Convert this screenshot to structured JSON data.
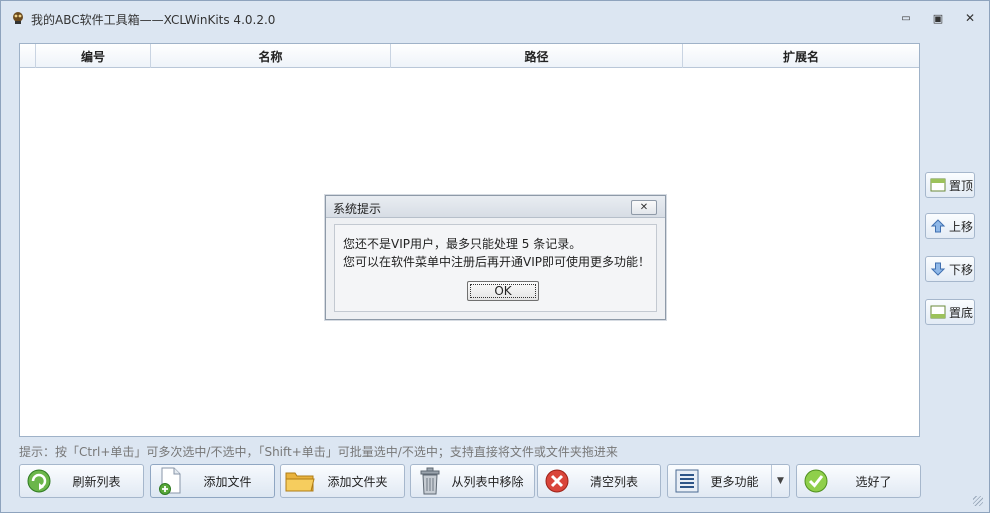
{
  "window": {
    "title": "我的ABC软件工具箱——XCLWinKits   4.0.2.0",
    "minimize_glyph": "▭",
    "maximize_glyph": "▣",
    "close_glyph": "✕"
  },
  "table": {
    "columns": [
      "",
      "编号",
      "名称",
      "路径",
      "扩展名"
    ],
    "rows": []
  },
  "side_buttons": {
    "top": "置顶",
    "up": "上移",
    "down": "下移",
    "bottom": "置底"
  },
  "hint": "提示：按「Ctrl+单击」可多次选中/不选中，「Shift+单击」可批量选中/不选中；支持直接将文件或文件夹拖进来",
  "bottom_buttons": {
    "refresh": "刷新列表",
    "add_file": "添加文件",
    "add_folder": "添加文件夹",
    "remove": "从列表中移除",
    "clear": "清空列表",
    "more": "更多功能",
    "done": "选好了"
  },
  "dialog": {
    "title": "系统提示",
    "line1": "您还不是VIP用户，最多只能处理 5 条记录。",
    "line2": "您可以在软件菜单中注册后再开通VIP即可使用更多功能！",
    "ok": "OK",
    "close_glyph": "✕"
  },
  "colors": {
    "window_bg": "#dce6f2",
    "accent_green": "#3c9a2e",
    "accent_red": "#d23a2e"
  }
}
